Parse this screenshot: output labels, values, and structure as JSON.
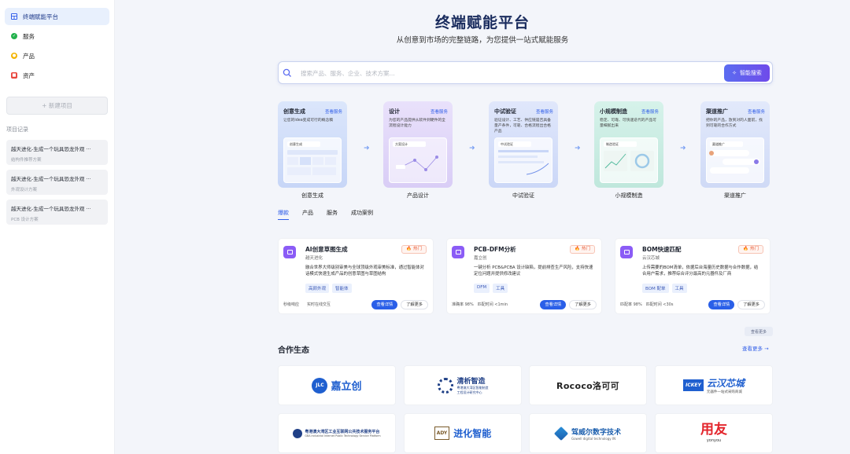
{
  "sidebar": {
    "items": [
      {
        "label": "终端赋能平台",
        "icon": "layout-icon",
        "active": true
      },
      {
        "label": "服务",
        "icon": "check-circle-icon"
      },
      {
        "label": "产品",
        "icon": "product-icon"
      },
      {
        "label": "资产",
        "icon": "asset-icon"
      }
    ],
    "new_project": "+ 新建项目",
    "records_title": "项目记录",
    "records": [
      {
        "title": "越天进化-生成一个玩具恐龙外观 ···",
        "sub": "结构件推荐方案"
      },
      {
        "title": "越天进化-生成一个玩具恐龙外观 ···",
        "sub": "外观设计方案"
      },
      {
        "title": "越天进化-生成一个玩具恐龙外观 ···",
        "sub": "PCB 设计方案"
      }
    ]
  },
  "header": {
    "title": "终端赋能平台",
    "subtitle": "从创意到市场的完整链路，为您提供一站式赋能服务"
  },
  "search": {
    "placeholder": "搜索产品、服务、企业、技术方案...",
    "button": "智能搜索"
  },
  "stages": [
    {
      "name": "创意生成",
      "link": "查看服务",
      "desc": "让您的idea变成可行的概念稿",
      "label": "创意生成",
      "mock": "创意生成",
      "bg": "#dbe6fb"
    },
    {
      "name": "设计",
      "link": "查看服务",
      "desc": "为您的产品提供从软件到硬件的全流程设计能力",
      "label": "产品设计",
      "mock": "方案设计",
      "bg": "#e6defa"
    },
    {
      "name": "中试验证",
      "link": "查看服务",
      "desc": "验证设计、工艺、供应链是否具备量产条件，可靠、合格流程出合格产品",
      "label": "中试验证",
      "mock": "中试验证",
      "bg": "#dde4fb"
    },
    {
      "name": "小规模制造",
      "link": "查看服务",
      "desc": "稳定、可靠、可快速迭代的产品可量细腻出来",
      "label": "小规模制造",
      "mock": "制造验证",
      "bg": "#d4f1ea"
    },
    {
      "name": "渠道推广",
      "link": "查看服务",
      "desc": "把你的产品，放到对的人面前，找到可靠的合作方式",
      "label": "渠道推广",
      "mock": "渠道推广",
      "bg": "#dde6fb"
    }
  ],
  "tabs": [
    {
      "label": "爆款",
      "active": true
    },
    {
      "label": "产品"
    },
    {
      "label": "服务"
    },
    {
      "label": "成功案例"
    }
  ],
  "cards": [
    {
      "title": "AI创意草图生成",
      "sub": "越天进化",
      "hot": "🔥 热门",
      "desc": "融合世界大师级别审美与全球顶级外观审美标准，通过智能体对话模式快速生成产品的创意草图与草图结构",
      "tags": [
        "高颜外观",
        "智能体"
      ],
      "meta": "秒级响应　　实时在线交互",
      "detail": "查看详情",
      "more": "了解更多"
    },
    {
      "title": "PCB-DFM分析",
      "sub": "嘉立创",
      "hot": "🔥 热门",
      "desc": "一键分析 PCB&PCBA 设计缺陷，提前排查生产风险，支持快速定位问题并提供修改建议",
      "tags": [
        "DFM",
        "工具"
      ],
      "meta": "准确率 98%　匹配时间 <1min",
      "detail": "查看详情",
      "more": "了解更多"
    },
    {
      "title": "BOM快速匹配",
      "sub": "云汉芯城",
      "hot": "🔥 热门",
      "desc": "上传需要的BOM清单，依据后台海量历史数据与合作数据，结合用户需求，推荐综合评分最高的元器件及厂商",
      "tags": [
        "BOM 配单",
        "工具"
      ],
      "meta": "匹配率 98%　匹配时间 <30s",
      "detail": "查看详情",
      "more": "了解更多"
    }
  ],
  "see_more_button": "查看更多",
  "ecosystem": {
    "title": "合作生态",
    "more": "查看更多 →",
    "partners": [
      {
        "name": "嘉立创",
        "mark": "JLC"
      },
      {
        "name": "清析智造",
        "sub1": "粤港澳大湾区智能制造",
        "sub2": "工程设计研究中心"
      },
      {
        "name": "Rococo洛可可"
      },
      {
        "name": "云汉芯城",
        "mark": "ICKEY",
        "sub1": "元器件一站式采购商城"
      },
      {
        "name": "粤港澳大湾区工业互联网公共技术服务平台",
        "sub1": "GBA Industrial Internet Public Technology Service Platform"
      },
      {
        "name": "进化智能",
        "mark": "ADY"
      },
      {
        "name": "驾威尔数字技术",
        "sub1": "Gowell digital technology IN"
      },
      {
        "name": "用友",
        "sub1": "yonyou"
      }
    ]
  },
  "colors": {
    "primary": "#2f5de8",
    "title": "#1a2c5e",
    "hot": "#e85d3a",
    "card_icon": "#8b5cf6"
  }
}
